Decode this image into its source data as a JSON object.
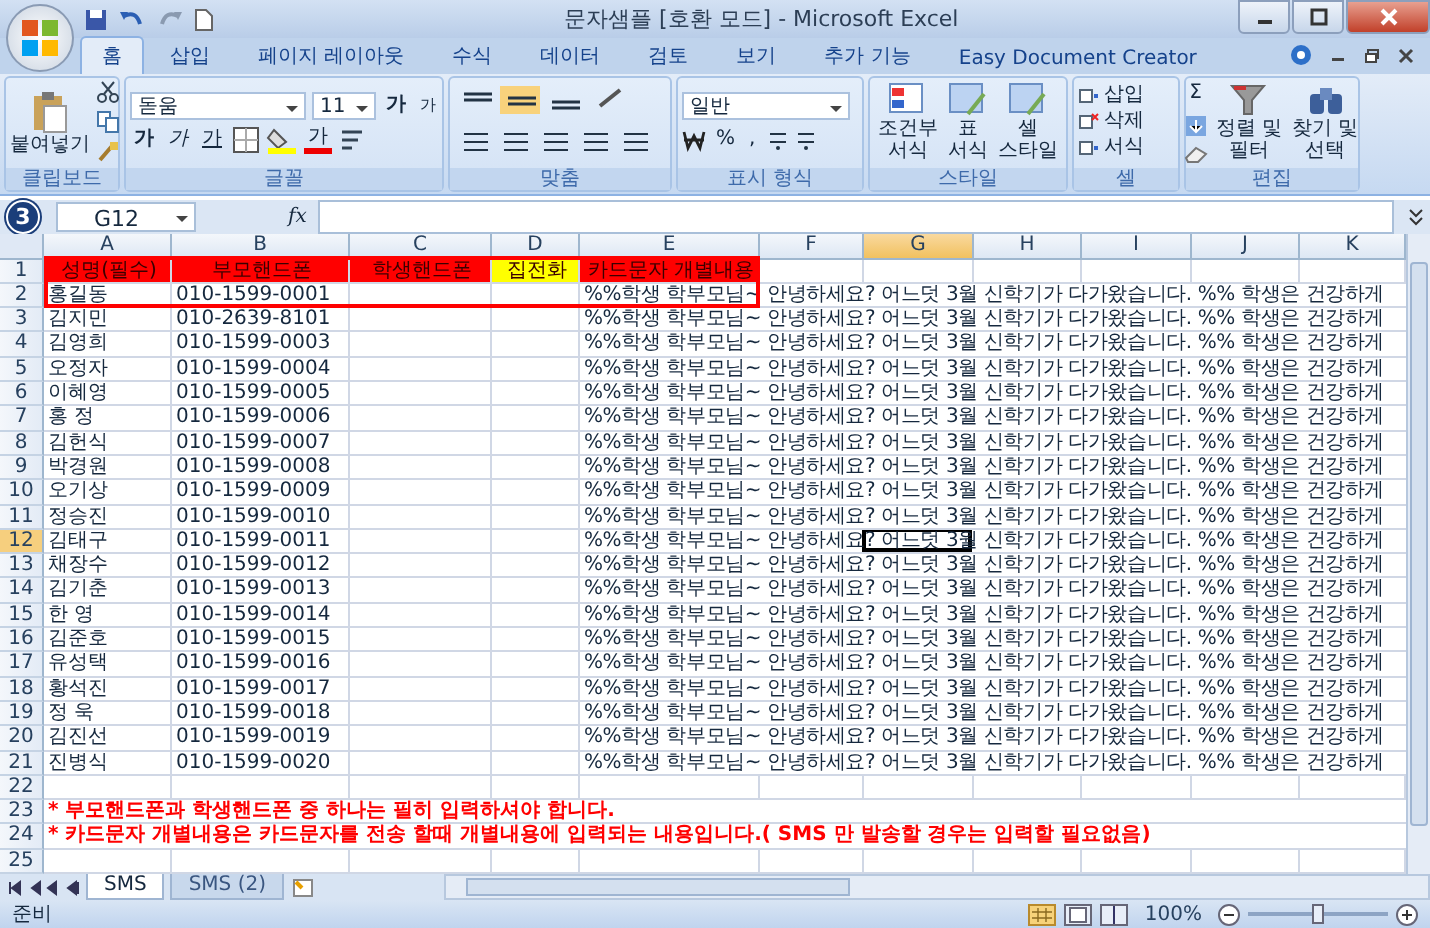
{
  "window": {
    "title": "문자샘플 [호환 모드] - Microsoft Excel"
  },
  "ribbon_tabs": [
    {
      "label": "홈",
      "selected": true
    },
    {
      "label": "삽입",
      "selected": false
    },
    {
      "label": "페이지 레이아웃",
      "selected": false
    },
    {
      "label": "수식",
      "selected": false
    },
    {
      "label": "데이터",
      "selected": false
    },
    {
      "label": "검토",
      "selected": false
    },
    {
      "label": "보기",
      "selected": false
    },
    {
      "label": "추가 기능",
      "selected": false
    },
    {
      "label": "Easy Document Creator",
      "selected": false
    }
  ],
  "ribbon": {
    "clipboard": {
      "paste": "붙여넣기",
      "label": "클립보드"
    },
    "font": {
      "name": "돋움",
      "size": "11",
      "grow": "가",
      "shrink": "가",
      "bold": "가",
      "italic": "가",
      "underline": "가",
      "font_color": "가",
      "label": "글꼴"
    },
    "alignment": {
      "label": "맞춤"
    },
    "number": {
      "format": "일반",
      "percent": "%",
      "comma": ",",
      "label": "표시 형식"
    },
    "styles": {
      "items": [
        [
          "조건부",
          "서식"
        ],
        [
          "표",
          "서식"
        ],
        [
          "셀",
          "스타일"
        ]
      ],
      "label": "스타일"
    },
    "cells": {
      "items": [
        "삽입",
        "삭제",
        "서식"
      ],
      "label": "셀"
    },
    "editing": {
      "sum": "Σ",
      "sort": [
        "정렬 및",
        "필터"
      ],
      "find": [
        "찾기 및",
        "선택"
      ],
      "label": "편집"
    }
  },
  "formula_bar": {
    "name_box": "G12",
    "fx": "fx"
  },
  "annotation": {
    "badge": "3"
  },
  "sheet": {
    "columns": [
      {
        "label": "A",
        "selected": false
      },
      {
        "label": "B",
        "selected": false
      },
      {
        "label": "C",
        "selected": false
      },
      {
        "label": "D",
        "selected": false
      },
      {
        "label": "E",
        "selected": false
      },
      {
        "label": "F",
        "selected": false
      },
      {
        "label": "G",
        "selected": true
      },
      {
        "label": "H",
        "selected": false
      },
      {
        "label": "I",
        "selected": false
      },
      {
        "label": "J",
        "selected": false
      },
      {
        "label": "K",
        "selected": false
      }
    ],
    "rows": [
      {
        "number": "1",
        "selected": false,
        "kind": "header",
        "cells": [
          {
            "text": "성명(필수)",
            "color": "#ff0000"
          },
          {
            "text": "부모핸드폰",
            "color": "#ff0000"
          },
          {
            "text": "학생핸드폰",
            "color": "#ff0000"
          },
          {
            "text": "집전화",
            "color": "#ffff00"
          },
          {
            "text": "카드문자 개별내용",
            "color": "#ff0000"
          }
        ]
      },
      {
        "number": "2",
        "selected": false,
        "kind": "record",
        "name": "홍길동",
        "phone": "010-1599-0001",
        "message": "%%학생 학부모님~ 안녕하세요? 어느덧 3월 신학기가 다가왔습니다. %% 학생은 건강하게"
      },
      {
        "number": "3",
        "selected": false,
        "kind": "record",
        "name": "김지민",
        "phone": "010-2639-8101",
        "message": "%%학생 학부모님~ 안녕하세요? 어느덧 3월 신학기가 다가왔습니다. %% 학생은 건강하게"
      },
      {
        "number": "4",
        "selected": false,
        "kind": "record",
        "name": "김영희",
        "phone": "010-1599-0003",
        "message": "%%학생 학부모님~ 안녕하세요? 어느덧 3월 신학기가 다가왔습니다. %% 학생은 건강하게"
      },
      {
        "number": "5",
        "selected": false,
        "kind": "record",
        "name": "오정자",
        "phone": "010-1599-0004",
        "message": "%%학생 학부모님~ 안녕하세요? 어느덧 3월 신학기가 다가왔습니다. %% 학생은 건강하게"
      },
      {
        "number": "6",
        "selected": false,
        "kind": "record",
        "name": "이혜영",
        "phone": "010-1599-0005",
        "message": "%%학생 학부모님~ 안녕하세요? 어느덧 3월 신학기가 다가왔습니다. %% 학생은 건강하게"
      },
      {
        "number": "7",
        "selected": false,
        "kind": "record",
        "name": "홍 정",
        "phone": "010-1599-0006",
        "message": "%%학생 학부모님~ 안녕하세요? 어느덧 3월 신학기가 다가왔습니다. %% 학생은 건강하게"
      },
      {
        "number": "8",
        "selected": false,
        "kind": "record",
        "name": "김헌식",
        "phone": "010-1599-0007",
        "message": "%%학생 학부모님~ 안녕하세요? 어느덧 3월 신학기가 다가왔습니다. %% 학생은 건강하게"
      },
      {
        "number": "9",
        "selected": false,
        "kind": "record",
        "name": "박경원",
        "phone": "010-1599-0008",
        "message": "%%학생 학부모님~ 안녕하세요? 어느덧 3월 신학기가 다가왔습니다. %% 학생은 건강하게"
      },
      {
        "number": "10",
        "selected": false,
        "kind": "record",
        "name": "오기상",
        "phone": "010-1599-0009",
        "message": "%%학생 학부모님~ 안녕하세요? 어느덧 3월 신학기가 다가왔습니다. %% 학생은 건강하게"
      },
      {
        "number": "11",
        "selected": false,
        "kind": "record",
        "name": "정승진",
        "phone": "010-1599-0010",
        "message": "%%학생 학부모님~ 안녕하세요? 어느덧 3월 신학기가 다가왔습니다. %% 학생은 건강하게"
      },
      {
        "number": "12",
        "selected": true,
        "kind": "record",
        "name": "김태구",
        "phone": "010-1599-0011",
        "message": "%%학생 학부모님~ 안녕하세요? 어느덧 3월 신학기가 다가왔습니다. %% 학생은 건강하게"
      },
      {
        "number": "13",
        "selected": false,
        "kind": "record",
        "name": "채장수",
        "phone": "010-1599-0012",
        "message": "%%학생 학부모님~ 안녕하세요? 어느덧 3월 신학기가 다가왔습니다. %% 학생은 건강하게"
      },
      {
        "number": "14",
        "selected": false,
        "kind": "record",
        "name": "김기춘",
        "phone": "010-1599-0013",
        "message": "%%학생 학부모님~ 안녕하세요? 어느덧 3월 신학기가 다가왔습니다. %% 학생은 건강하게"
      },
      {
        "number": "15",
        "selected": false,
        "kind": "record",
        "name": "한 영",
        "phone": "010-1599-0014",
        "message": "%%학생 학부모님~ 안녕하세요? 어느덧 3월 신학기가 다가왔습니다. %% 학생은 건강하게"
      },
      {
        "number": "16",
        "selected": false,
        "kind": "record",
        "name": "김준호",
        "phone": "010-1599-0015",
        "message": "%%학생 학부모님~ 안녕하세요? 어느덧 3월 신학기가 다가왔습니다. %% 학생은 건강하게"
      },
      {
        "number": "17",
        "selected": false,
        "kind": "record",
        "name": "유성택",
        "phone": "010-1599-0016",
        "message": "%%학생 학부모님~ 안녕하세요? 어느덧 3월 신학기가 다가왔습니다. %% 학생은 건강하게"
      },
      {
        "number": "18",
        "selected": false,
        "kind": "record",
        "name": "황석진",
        "phone": "010-1599-0017",
        "message": "%%학생 학부모님~ 안녕하세요? 어느덧 3월 신학기가 다가왔습니다. %% 학생은 건강하게"
      },
      {
        "number": "19",
        "selected": false,
        "kind": "record",
        "name": "정 욱",
        "phone": "010-1599-0018",
        "message": "%%학생 학부모님~ 안녕하세요? 어느덧 3월 신학기가 다가왔습니다. %% 학생은 건강하게"
      },
      {
        "number": "20",
        "selected": false,
        "kind": "record",
        "name": "김진선",
        "phone": "010-1599-0019",
        "message": "%%학생 학부모님~ 안녕하세요? 어느덧 3월 신학기가 다가왔습니다. %% 학생은 건강하게"
      },
      {
        "number": "21",
        "selected": false,
        "kind": "record",
        "name": "진병식",
        "phone": "010-1599-0020",
        "message": "%%학생 학부모님~ 안녕하세요? 어느덧 3월 신학기가 다가왔습니다. %% 학생은 건강하게"
      },
      {
        "number": "22",
        "selected": false,
        "kind": "blank"
      },
      {
        "number": "23",
        "selected": false,
        "kind": "note",
        "text": "* 부모핸드폰과 학생핸드폰 중 하나는 필히 입력하셔야 합니다."
      },
      {
        "number": "24",
        "selected": false,
        "kind": "note",
        "text": "* 카드문자 개별내용은 카드문자를 전송 할때 개별내용에 입력되는 내용입니다.( SMS 만 발송할 경우는 입력할 필요없음)"
      },
      {
        "number": "25",
        "selected": false,
        "kind": "blank"
      }
    ]
  },
  "sheet_tabs": [
    {
      "label": "SMS",
      "selected": true
    },
    {
      "label": "SMS (2)",
      "selected": false
    }
  ],
  "status_bar": {
    "status": "준비",
    "zoom": {
      "label": "100%",
      "level": 0.5
    }
  }
}
